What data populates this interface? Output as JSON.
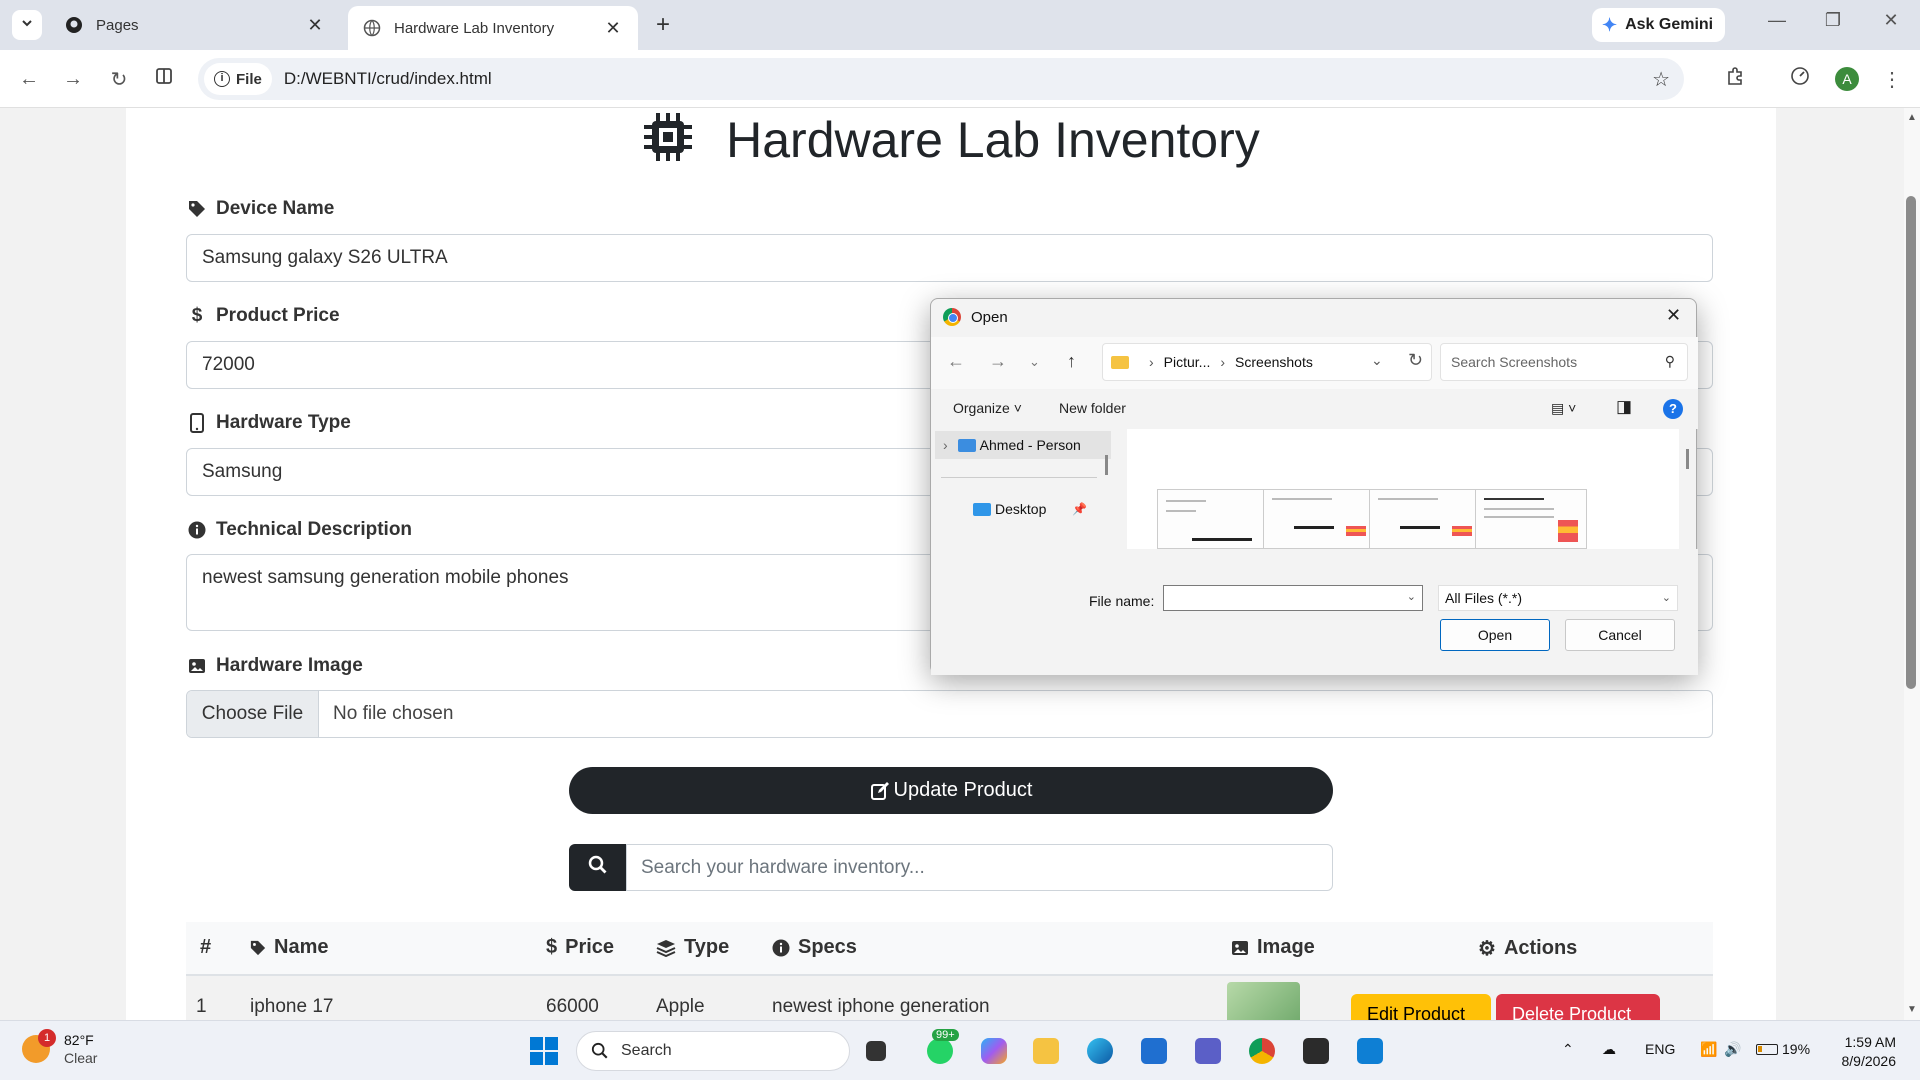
{
  "browser": {
    "tabs": [
      {
        "title": "Pages",
        "active": false
      },
      {
        "title": "Hardware Lab Inventory",
        "active": true
      }
    ],
    "gemini_label": "Ask Gemini",
    "file_chip": "File",
    "url": "D:/WEBNTI/crud/index.html",
    "avatar_letter": "A"
  },
  "page": {
    "title": "Hardware Lab Inventory",
    "form": {
      "device_name_label": "Device Name",
      "device_name_value": "Samsung galaxy S26 ULTRA",
      "price_label": "Product Price",
      "price_value": "72000",
      "type_label": "Hardware Type",
      "type_value": "Samsung",
      "desc_label": "Technical Description",
      "desc_value": "newest samsung generation mobile phones",
      "image_label": "Hardware Image",
      "choose_file": "Choose File",
      "no_file": "No file chosen"
    },
    "update_button": "Update Product",
    "search_placeholder": "Search your hardware inventory...",
    "table": {
      "headers": [
        "#",
        "Name",
        "Price",
        "Type",
        "Specs",
        "Image",
        "Actions"
      ],
      "row1": {
        "index": "1",
        "name": "iphone 17",
        "price": "66000",
        "type": "Apple",
        "specs": "newest iphone generation",
        "edit": "Edit Product",
        "delete": "Delete Product"
      }
    }
  },
  "dialog": {
    "title": "Open",
    "breadcrumb": [
      "Pictur...",
      "Screenshots"
    ],
    "search_placeholder": "Search Screenshots",
    "organize": "Organize",
    "new_folder": "New folder",
    "nav_items": [
      "Ahmed - Person",
      "Desktop"
    ],
    "file_name_label": "File name:",
    "file_name_value": "",
    "file_type": "All Files (*.*)",
    "open_button": "Open",
    "cancel_button": "Cancel"
  },
  "taskbar": {
    "weather_temp": "82°F",
    "weather_desc": "Clear",
    "weather_badge": "1",
    "search_label": "Search",
    "whatsapp_badge": "99+",
    "language": "ENG",
    "battery": "19%",
    "time": "1:59 AM",
    "date": "8/9/2026"
  },
  "colors": {
    "primary_dark": "#212529",
    "edit_button": "#ffc107",
    "delete_button": "#dc3545",
    "accent_blue": "#0078d4"
  }
}
